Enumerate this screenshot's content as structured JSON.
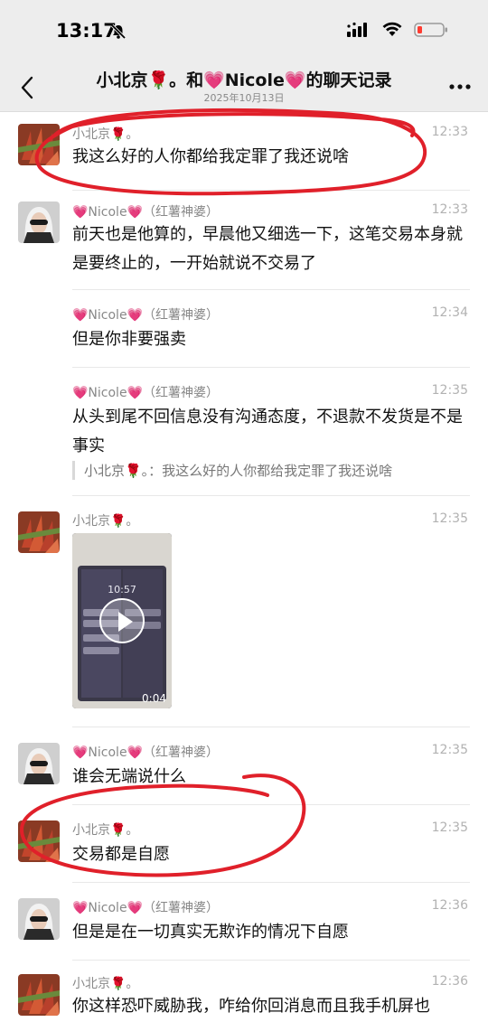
{
  "status_bar": {
    "time": "13:17",
    "icons": [
      "mute-bell-icon",
      "signal-icon",
      "wifi-icon",
      "battery-low-icon"
    ],
    "battery_color": "#ff3b30"
  },
  "header": {
    "back_icon": "chevron-left-icon",
    "title": "小北京🌹。和💗Nicole💗的聊天记录",
    "subtitle": "2025年10月13日",
    "more_icon": "more-dots-icon"
  },
  "annotation_color": "#e0202a",
  "messages": [
    {
      "sender": "小北京🌹。",
      "time": "12:33",
      "text": "我这么好的人你都给我定罪了我还说啥",
      "avatar": "rose-avatar"
    },
    {
      "sender": "💗Nicole💗（红薯神婆）",
      "time": "12:33",
      "text": "前天也是他算的，早晨他又细选一下，这笔交易本身就是要终止的，一开始就说不交易了",
      "avatar": "nicole-avatar"
    },
    {
      "sender": "💗Nicole💗（红薯神婆）",
      "time": "12:34",
      "text": "但是你非要强卖"
    },
    {
      "sender": "💗Nicole💗（红薯神婆）",
      "time": "12:35",
      "text": "从头到尾不回信息没有沟通态度，不退款不发货是不是事实",
      "quote": "小北京🌹。：我这么好的人你都给我定罪了我还说啥"
    },
    {
      "sender": "小北京🌹。",
      "time": "12:35",
      "video_time_text": "10:57",
      "video_duration": "0:04",
      "avatar": "rose-avatar"
    },
    {
      "sender": "💗Nicole💗（红薯神婆）",
      "time": "12:35",
      "text": "谁会无端说什么",
      "avatar": "nicole-avatar"
    },
    {
      "sender": "小北京🌹。",
      "time": "12:35",
      "text": "交易都是自愿",
      "avatar": "rose-avatar"
    },
    {
      "sender": "💗Nicole💗（红薯神婆）",
      "time": "12:36",
      "text": "但是是在一切真实无欺诈的情况下自愿",
      "avatar": "nicole-avatar"
    },
    {
      "sender": "小北京🌹。",
      "time": "12:36",
      "text": "你这样恐吓威胁我，咋给你回消息而且我手机屏也",
      "avatar": "rose-avatar"
    }
  ]
}
